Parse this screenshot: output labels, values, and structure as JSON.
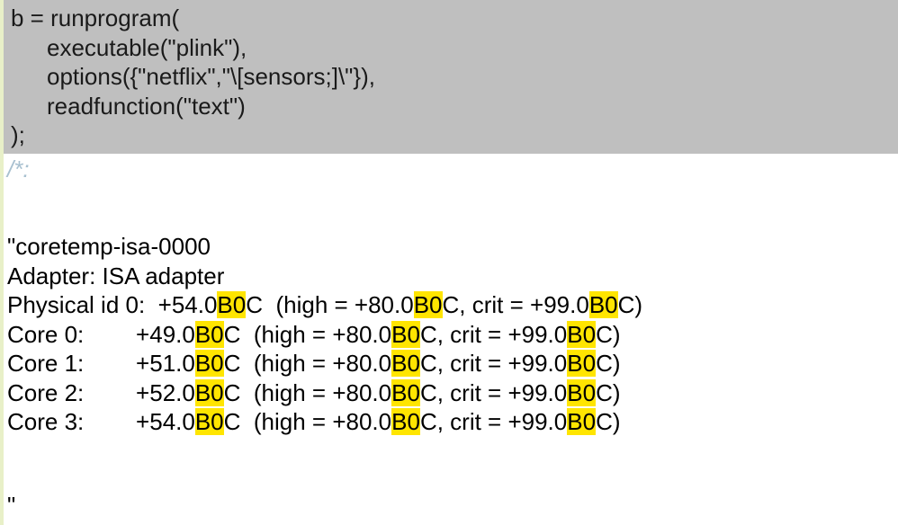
{
  "code": {
    "line1": "b = runprogram(",
    "line2": "executable(\"plink\"),",
    "line3": "options({\"netflix\",\"\\[sensors;]\\\"}),",
    "line4": "readfunction(\"text\")",
    "line5": ");"
  },
  "comment": "/*:",
  "output": {
    "open_quote": "\"",
    "header": "coretemp-isa-0000",
    "adapter": "Adapter: ISA adapter",
    "rows": [
      {
        "label": "Physical id 0:  +54.0",
        "hl1": "B0",
        "mid1": "C  (high = +80.0",
        "hl2": "B0",
        "mid2": "C, crit = +99.0",
        "hl3": "B0",
        "end": "C)"
      },
      {
        "label": "Core 0:        +49.0",
        "hl1": "B0",
        "mid1": "C  (high = +80.0",
        "hl2": "B0",
        "mid2": "C, crit = +99.0",
        "hl3": "B0",
        "end": "C)"
      },
      {
        "label": "Core 1:        +51.0",
        "hl1": "B0",
        "mid1": "C  (high = +80.0",
        "hl2": "B0",
        "mid2": "C, crit = +99.0",
        "hl3": "B0",
        "end": "C)"
      },
      {
        "label": "Core 2:        +52.0",
        "hl1": "B0",
        "mid1": "C  (high = +80.0",
        "hl2": "B0",
        "mid2": "C, crit = +99.0",
        "hl3": "B0",
        "end": "C)"
      },
      {
        "label": "Core 3:        +54.0",
        "hl1": "B0",
        "mid1": "C  (high = +80.0",
        "hl2": "B0",
        "mid2": "C, crit = +99.0",
        "hl3": "B0",
        "end": "C)"
      }
    ],
    "close_quote": "\""
  }
}
